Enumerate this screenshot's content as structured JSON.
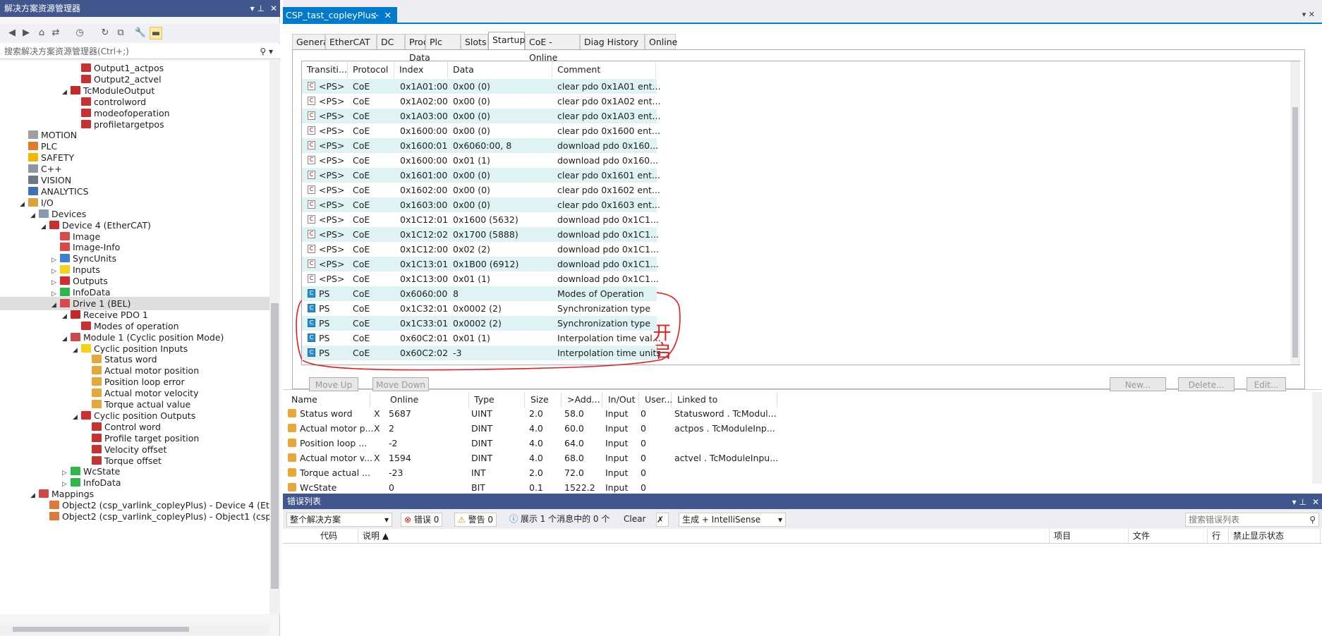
{
  "solution_explorer": {
    "title": "解决方案资源管理器",
    "pin": "▾ ⊥",
    "close": "✕",
    "search_placeholder": "搜索解决方案资源管理器(Ctrl+;)",
    "tree": [
      {
        "label": "Output1_actpos",
        "indent": 7,
        "icon": "output-var-icon",
        "expander": ""
      },
      {
        "label": "Output2_actvel",
        "indent": 7,
        "icon": "output-var-icon",
        "expander": ""
      },
      {
        "label": "TcModuleOutput",
        "indent": 6,
        "icon": "output-folder-icon",
        "expander": "◢"
      },
      {
        "label": "controlword",
        "indent": 7,
        "icon": "output-var-icon",
        "expander": ""
      },
      {
        "label": "modeofoperation",
        "indent": 7,
        "icon": "output-var-icon",
        "expander": ""
      },
      {
        "label": "profiletargetpos",
        "indent": 7,
        "icon": "output-var-icon",
        "expander": ""
      },
      {
        "label": "MOTION",
        "indent": 2,
        "icon": "motion-icon",
        "expander": ""
      },
      {
        "label": "PLC",
        "indent": 2,
        "icon": "plc-icon",
        "expander": ""
      },
      {
        "label": "SAFETY",
        "indent": 2,
        "icon": "safety-icon",
        "expander": ""
      },
      {
        "label": "C++",
        "indent": 2,
        "icon": "cpp-icon",
        "expander": ""
      },
      {
        "label": "VISION",
        "indent": 2,
        "icon": "vision-icon",
        "expander": ""
      },
      {
        "label": "ANALYTICS",
        "indent": 2,
        "icon": "analytics-icon",
        "expander": ""
      },
      {
        "label": "I/O",
        "indent": 2,
        "icon": "io-icon",
        "expander": "◢"
      },
      {
        "label": "Devices",
        "indent": 3,
        "icon": "devices-icon",
        "expander": "◢"
      },
      {
        "label": "Device 4 (EtherCAT)",
        "indent": 4,
        "icon": "ethercat-device-icon",
        "expander": "◢"
      },
      {
        "label": "Image",
        "indent": 5,
        "icon": "image-icon",
        "expander": ""
      },
      {
        "label": "Image-Info",
        "indent": 5,
        "icon": "image-icon",
        "expander": ""
      },
      {
        "label": "SyncUnits",
        "indent": 5,
        "icon": "syncunits-icon",
        "expander": "▷"
      },
      {
        "label": "Inputs",
        "indent": 5,
        "icon": "inputs-icon",
        "expander": "▷"
      },
      {
        "label": "Outputs",
        "indent": 5,
        "icon": "outputs-icon",
        "expander": "▷"
      },
      {
        "label": "InfoData",
        "indent": 5,
        "icon": "infodata-icon",
        "expander": "▷"
      },
      {
        "label": "Drive 1 (BEL)",
        "indent": 5,
        "icon": "drive-icon",
        "expander": "◢",
        "selected": true
      },
      {
        "label": "Receive PDO 1",
        "indent": 6,
        "icon": "pdo-icon",
        "expander": "◢"
      },
      {
        "label": "Modes of operation",
        "indent": 7,
        "icon": "output-var-icon",
        "expander": ""
      },
      {
        "label": "Module 1 (Cyclic position Mode)",
        "indent": 6,
        "icon": "module-icon",
        "expander": "◢"
      },
      {
        "label": "Cyclic position Inputs",
        "indent": 7,
        "icon": "inputs-icon",
        "expander": "◢"
      },
      {
        "label": "Status word",
        "indent": 8,
        "icon": "input-var-icon",
        "expander": ""
      },
      {
        "label": "Actual motor position",
        "indent": 8,
        "icon": "input-var-icon",
        "expander": ""
      },
      {
        "label": "Position loop error",
        "indent": 8,
        "icon": "input-var-icon",
        "expander": ""
      },
      {
        "label": "Actual motor velocity",
        "indent": 8,
        "icon": "input-var-icon",
        "expander": ""
      },
      {
        "label": "Torque actual value",
        "indent": 8,
        "icon": "input-var-icon",
        "expander": ""
      },
      {
        "label": "Cyclic position Outputs",
        "indent": 7,
        "icon": "outputs-icon",
        "expander": "◢"
      },
      {
        "label": "Control word",
        "indent": 8,
        "icon": "output-var-icon",
        "expander": ""
      },
      {
        "label": "Profile target position",
        "indent": 8,
        "icon": "output-var-icon",
        "expander": ""
      },
      {
        "label": "Velocity offset",
        "indent": 8,
        "icon": "output-var-icon",
        "expander": ""
      },
      {
        "label": "Torque offset",
        "indent": 8,
        "icon": "output-var-icon",
        "expander": ""
      },
      {
        "label": "WcState",
        "indent": 6,
        "icon": "infodata-icon",
        "expander": "▷"
      },
      {
        "label": "InfoData",
        "indent": 6,
        "icon": "infodata-icon",
        "expander": "▷"
      },
      {
        "label": "Mappings",
        "indent": 3,
        "icon": "mappings-icon",
        "expander": "◢"
      },
      {
        "label": "Object2 (csp_varlink_copleyPlus) - Device 4 (EtherCAT)",
        "indent": 4,
        "icon": "mapping-item-icon",
        "expander": ""
      },
      {
        "label": "Object2 (csp_varlink_copleyPlus) - Object1 (csp",
        "indent": 4,
        "icon": "mapping-item-icon",
        "expander": ""
      }
    ]
  },
  "document": {
    "tab_title": "CSP_tast_copleyPlus",
    "tab_pin": "⊹",
    "tab_close": "✕",
    "window_ctrl": "▾ ✕",
    "property_tabs": [
      "General",
      "EtherCAT",
      "DC",
      "Process Data",
      "Plc",
      "Slots",
      "Startup",
      "CoE - Online",
      "Diag History",
      "Online"
    ],
    "active_tab": "Startup",
    "startup_columns": [
      "Transiti...",
      "Protocol",
      "Index",
      "Data",
      "Comment"
    ],
    "startup_rows": [
      {
        "icon": "C",
        "transition": "<PS>",
        "protocol": "CoE",
        "index": "0x1A01:00",
        "data": "0x00 (0)",
        "comment": "clear pdo 0x1A01 ent..."
      },
      {
        "icon": "C",
        "transition": "<PS>",
        "protocol": "CoE",
        "index": "0x1A02:00",
        "data": "0x00 (0)",
        "comment": "clear pdo 0x1A02 ent..."
      },
      {
        "icon": "C",
        "transition": "<PS>",
        "protocol": "CoE",
        "index": "0x1A03:00",
        "data": "0x00 (0)",
        "comment": "clear pdo 0x1A03 ent..."
      },
      {
        "icon": "C",
        "transition": "<PS>",
        "protocol": "CoE",
        "index": "0x1600:00",
        "data": "0x00 (0)",
        "comment": "clear pdo 0x1600 ent..."
      },
      {
        "icon": "C",
        "transition": "<PS>",
        "protocol": "CoE",
        "index": "0x1600:01",
        "data": "0x6060:00, 8",
        "comment": "download pdo 0x160..."
      },
      {
        "icon": "C",
        "transition": "<PS>",
        "protocol": "CoE",
        "index": "0x1600:00",
        "data": "0x01 (1)",
        "comment": "download pdo 0x160..."
      },
      {
        "icon": "C",
        "transition": "<PS>",
        "protocol": "CoE",
        "index": "0x1601:00",
        "data": "0x00 (0)",
        "comment": "clear pdo 0x1601 ent..."
      },
      {
        "icon": "C",
        "transition": "<PS>",
        "protocol": "CoE",
        "index": "0x1602:00",
        "data": "0x00 (0)",
        "comment": "clear pdo 0x1602 ent..."
      },
      {
        "icon": "C",
        "transition": "<PS>",
        "protocol": "CoE",
        "index": "0x1603:00",
        "data": "0x00 (0)",
        "comment": "clear pdo 0x1603 ent..."
      },
      {
        "icon": "C",
        "transition": "<PS>",
        "protocol": "CoE",
        "index": "0x1C12:01",
        "data": "0x1600 (5632)",
        "comment": "download pdo 0x1C1..."
      },
      {
        "icon": "C",
        "transition": "<PS>",
        "protocol": "CoE",
        "index": "0x1C12:02",
        "data": "0x1700 (5888)",
        "comment": "download pdo 0x1C1..."
      },
      {
        "icon": "C",
        "transition": "<PS>",
        "protocol": "CoE",
        "index": "0x1C12:00",
        "data": "0x02 (2)",
        "comment": "download pdo 0x1C1..."
      },
      {
        "icon": "C",
        "transition": "<PS>",
        "protocol": "CoE",
        "index": "0x1C13:01",
        "data": "0x1B00 (6912)",
        "comment": "download pdo 0x1C1..."
      },
      {
        "icon": "C",
        "transition": "<PS>",
        "protocol": "CoE",
        "index": "0x1C13:00",
        "data": "0x01 (1)",
        "comment": "download pdo 0x1C1..."
      },
      {
        "icon": "C",
        "transition": "PS",
        "protocol": "CoE",
        "index": "0x6060:00",
        "data": "8",
        "comment": "Modes of Operation",
        "ps": true
      },
      {
        "icon": "C",
        "transition": "PS",
        "protocol": "CoE",
        "index": "0x1C32:01",
        "data": "0x0002 (2)",
        "comment": "Synchronization type",
        "ps": true
      },
      {
        "icon": "C",
        "transition": "PS",
        "protocol": "CoE",
        "index": "0x1C33:01",
        "data": "0x0002 (2)",
        "comment": "Synchronization type",
        "ps": true
      },
      {
        "icon": "C",
        "transition": "PS",
        "protocol": "CoE",
        "index": "0x60C2:01",
        "data": "0x01 (1)",
        "comment": "Interpolation time val...",
        "ps": true
      },
      {
        "icon": "C",
        "transition": "PS",
        "protocol": "CoE",
        "index": "0x60C2:02",
        "data": "-3",
        "comment": "Interpolation time units",
        "ps": true
      }
    ],
    "buttons": [
      "Move Up",
      "Move Down",
      "New...",
      "Delete...",
      "Edit..."
    ],
    "annotation_text": "开启"
  },
  "variables": {
    "columns": [
      "Name",
      "Online",
      "Type",
      "Size",
      ">Add...",
      "In/Out",
      "User...",
      "Linked to"
    ],
    "rows": [
      {
        "name": "Status word",
        "x": "X",
        "online": "5687",
        "type": "UINT",
        "size": "2.0",
        "addr": "58.0",
        "inout": "Input",
        "user": "0",
        "linked": "Statusword . TcModul..."
      },
      {
        "name": "Actual motor p...",
        "x": "X",
        "online": "2",
        "type": "DINT",
        "size": "4.0",
        "addr": "60.0",
        "inout": "Input",
        "user": "0",
        "linked": "actpos . TcModuleInp..."
      },
      {
        "name": "Position loop ...",
        "x": "",
        "online": "-2",
        "type": "DINT",
        "size": "4.0",
        "addr": "64.0",
        "inout": "Input",
        "user": "0",
        "linked": ""
      },
      {
        "name": "Actual motor v...",
        "x": "X",
        "online": "1594",
        "type": "DINT",
        "size": "4.0",
        "addr": "68.0",
        "inout": "Input",
        "user": "0",
        "linked": "actvel . TcModuleInpu..."
      },
      {
        "name": "Torque actual ...",
        "x": "",
        "online": "-23",
        "type": "INT",
        "size": "2.0",
        "addr": "72.0",
        "inout": "Input",
        "user": "0",
        "linked": ""
      },
      {
        "name": "WcState",
        "x": "",
        "online": "0",
        "type": "BIT",
        "size": "0.1",
        "addr": "1522.2",
        "inout": "Input",
        "user": "0",
        "linked": ""
      }
    ]
  },
  "error_list": {
    "title": "错误列表",
    "scope": "整个解决方案",
    "errors": "错误 0",
    "warnings": "警告 0",
    "messages": "展示 1 个消息中的 0 个",
    "clear": "Clear",
    "build": "生成 + IntelliSense",
    "search_placeholder": "搜索错误列表",
    "columns": [
      "代码",
      "说明 ▲",
      "项目",
      "文件",
      "行",
      "禁止显示状态"
    ]
  },
  "colors": {
    "accent": "#007acc",
    "title_bar": "#40568d",
    "row_alt": "#dff3f4",
    "annotation": "#e02020"
  }
}
